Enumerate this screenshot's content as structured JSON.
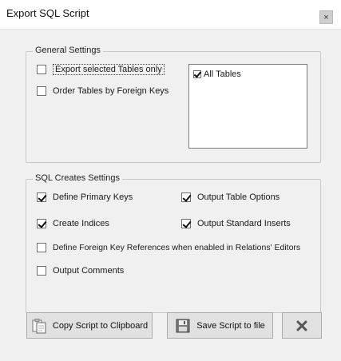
{
  "window": {
    "title": "Export SQL Script",
    "close_glyph": "×"
  },
  "general_settings": {
    "title": "General Settings",
    "options": [
      {
        "label": "Export selected Tables only",
        "checked": false
      },
      {
        "label": "Order Tables by Foreign Keys",
        "checked": false
      }
    ],
    "table_list": [
      {
        "label": "All Tables",
        "checked": true
      }
    ]
  },
  "sql_creates_settings": {
    "title": "SQL Creates Settings",
    "options": {
      "define_primary_keys": {
        "label": "Define Primary Keys",
        "checked": true
      },
      "output_table_options": {
        "label": "Output Table Options",
        "checked": true
      },
      "create_indices": {
        "label": "Create Indices",
        "checked": true
      },
      "output_standard_inserts": {
        "label": "Output Standard Inserts",
        "checked": true
      },
      "define_foreign_keys": {
        "label": "Define Foreign Key References when enabled in Relations' Editors",
        "checked": false
      },
      "output_comments": {
        "label": "Output Comments",
        "checked": false
      }
    }
  },
  "buttons": {
    "copy": {
      "label": "Copy Script to Clipboard",
      "icon": "clipboard-icon"
    },
    "save": {
      "label": "Save Script to file",
      "icon": "floppy-disk-icon"
    },
    "cancel": {
      "icon": "cancel-x-icon"
    }
  }
}
